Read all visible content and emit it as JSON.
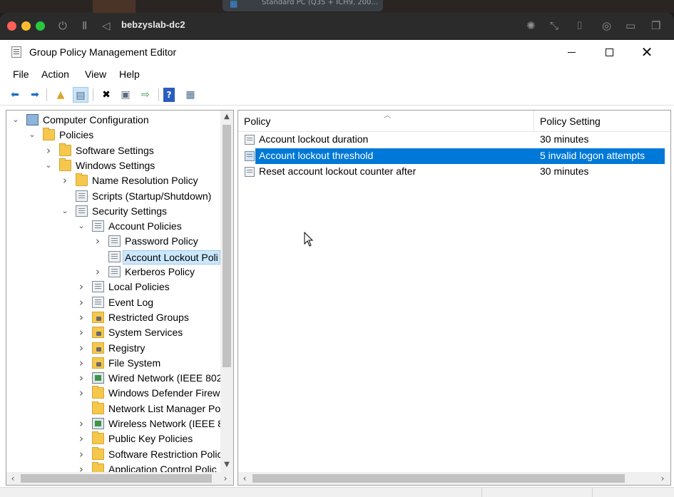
{
  "host": {
    "thumbnail_text": "Standard PC (Q35 + ICH9, 200..."
  },
  "vm": {
    "name": "bebzyslab-dc2"
  },
  "app": {
    "title": "Group Policy Management Editor"
  },
  "menu": [
    "File",
    "Action",
    "View",
    "Help"
  ],
  "tree": [
    {
      "label": "Computer Configuration",
      "icon": "computer-icon",
      "expander": "expanded"
    },
    {
      "label": "Policies",
      "icon": "folder-icon",
      "expander": "expanded"
    },
    {
      "label": "Software Settings",
      "icon": "folder-icon",
      "expander": "collapsed"
    },
    {
      "label": "Windows Settings",
      "icon": "folder-icon",
      "expander": "expanded"
    },
    {
      "label": "Name Resolution Policy",
      "icon": "folder-icon",
      "expander": "collapsed"
    },
    {
      "label": "Scripts (Startup/Shutdown)",
      "icon": "script-icon",
      "expander": "none"
    },
    {
      "label": "Security Settings",
      "icon": "security-icon",
      "expander": "expanded"
    },
    {
      "label": "Account Policies",
      "icon": "policy-icon",
      "expander": "expanded"
    },
    {
      "label": "Password Policy",
      "icon": "policy-icon",
      "expander": "collapsed"
    },
    {
      "label": "Account Lockout Poli",
      "icon": "policy-icon",
      "expander": "none",
      "selected": true
    },
    {
      "label": "Kerberos Policy",
      "icon": "policy-icon",
      "expander": "collapsed"
    },
    {
      "label": "Local Policies",
      "icon": "policy-icon",
      "expander": "collapsed"
    },
    {
      "label": "Event Log",
      "icon": "policy-icon",
      "expander": "collapsed"
    },
    {
      "label": "Restricted Groups",
      "icon": "lock-folder-icon",
      "expander": "collapsed"
    },
    {
      "label": "System Services",
      "icon": "lock-folder-icon",
      "expander": "collapsed"
    },
    {
      "label": "Registry",
      "icon": "lock-folder-icon",
      "expander": "collapsed"
    },
    {
      "label": "File System",
      "icon": "lock-folder-icon",
      "expander": "collapsed"
    },
    {
      "label": "Wired Network (IEEE 802.",
      "icon": "network-icon",
      "expander": "collapsed"
    },
    {
      "label": "Windows Defender Firew",
      "icon": "folder-icon",
      "expander": "collapsed"
    },
    {
      "label": "Network List Manager Po",
      "icon": "folder-icon",
      "expander": "none"
    },
    {
      "label": "Wireless Network (IEEE 80",
      "icon": "network-icon",
      "expander": "collapsed"
    },
    {
      "label": "Public Key Policies",
      "icon": "folder-icon",
      "expander": "collapsed"
    },
    {
      "label": "Software Restriction Polic",
      "icon": "folder-icon",
      "expander": "collapsed"
    },
    {
      "label": "Application Control Polic",
      "icon": "folder-icon",
      "expander": "collapsed"
    }
  ],
  "list": {
    "columns": [
      "Policy",
      "Policy Setting"
    ],
    "rows": [
      {
        "policy": "Account lockout duration",
        "setting": "30 minutes"
      },
      {
        "policy": "Account lockout threshold",
        "setting": "5 invalid logon attempts",
        "selected": true
      },
      {
        "policy": "Reset account lockout counter after",
        "setting": "30 minutes"
      }
    ]
  },
  "colors": {
    "selection": "#0078d7",
    "tree_selection": "#cce8ff",
    "folder": "#f5c84d"
  }
}
